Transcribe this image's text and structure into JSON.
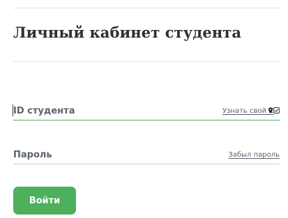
{
  "page": {
    "title": "Личный кабинет студента"
  },
  "form": {
    "student_id": {
      "label": "ID студента",
      "value": "",
      "link_text": "Узнать свой ID"
    },
    "password": {
      "label": "Пароль",
      "value": "",
      "link_text": "Забыл пароль"
    },
    "submit_label": "Войти"
  },
  "colors": {
    "accent": "#4cb05c",
    "text_dark": "#2b3035",
    "text_muted": "#5a636d",
    "divider": "#e3e4e6"
  },
  "icons": [
    "location-pin-icon",
    "checkbox-icon"
  ]
}
